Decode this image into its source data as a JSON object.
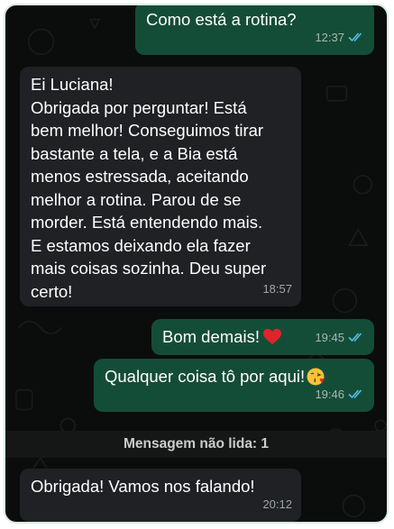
{
  "chat": {
    "messages": [
      {
        "direction": "outgoing",
        "text": "Como está a rotina?",
        "time": "12:37",
        "status": "read"
      },
      {
        "direction": "incoming",
        "text": "Ei Luciana!\nObrigada por perguntar! Está\nbem melhor! Conseguimos tirar\nbastante a tela, e a Bia está\nmenos estressada, aceitando\nmelhor a rotina. Parou de se\nmorder. Está entendendo mais.\nE estamos deixando ela fazer\nmais coisas sozinha. Deu super\ncerto!",
        "time": "18:57"
      },
      {
        "direction": "outgoing",
        "text": "Bom demais!",
        "emoji": "red-heart",
        "time": "19:45",
        "status": "read"
      },
      {
        "direction": "outgoing",
        "text": "Qualquer coisa tô por aqui!",
        "emoji": "face-blowing-kiss",
        "time": "19:46",
        "status": "read"
      },
      {
        "direction": "incoming",
        "text": "Obrigada! Vamos nos falando!",
        "time": "20:12"
      }
    ],
    "unread_divider": "Mensagem não lida: 1"
  },
  "colors": {
    "background": "#0b0d0c",
    "outgoing_bubble": "#144d37",
    "incoming_bubble": "#1f2124",
    "read_ticks": "#53bdeb",
    "frame_border": "#d6ecdf"
  }
}
